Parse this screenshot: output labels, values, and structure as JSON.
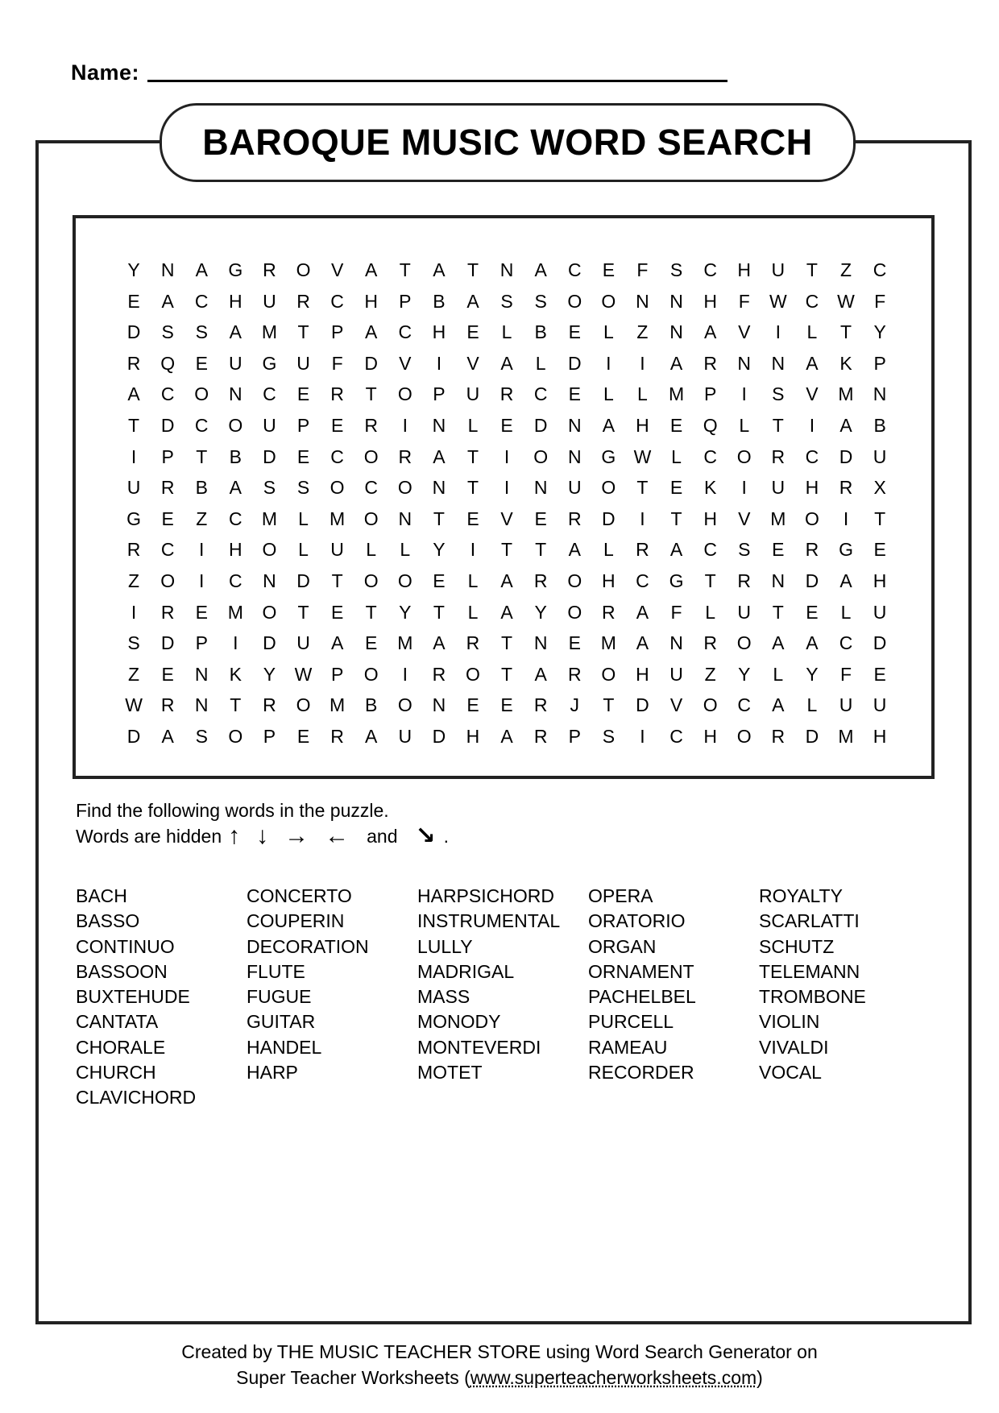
{
  "header": {
    "name_label": "Name:",
    "title": "BAROQUE MUSIC WORD SEARCH"
  },
  "grid": {
    "rows": [
      [
        "Y",
        "N",
        "A",
        "G",
        "R",
        "O",
        "V",
        "A",
        "T",
        "A",
        "T",
        "N",
        "A",
        "C",
        "E",
        "F",
        "S",
        "C",
        "H",
        "U",
        "T",
        "Z",
        "C"
      ],
      [
        "E",
        "A",
        "C",
        "H",
        "U",
        "R",
        "C",
        "H",
        "P",
        "B",
        "A",
        "S",
        "S",
        "O",
        "O",
        "N",
        "N",
        "H",
        "F",
        "W",
        "C",
        "W",
        "F"
      ],
      [
        "D",
        "S",
        "S",
        "A",
        "M",
        "T",
        "P",
        "A",
        "C",
        "H",
        "E",
        "L",
        "B",
        "E",
        "L",
        "Z",
        "N",
        "A",
        "V",
        "I",
        "L",
        "T",
        "Y"
      ],
      [
        "R",
        "Q",
        "E",
        "U",
        "G",
        "U",
        "F",
        "D",
        "V",
        "I",
        "V",
        "A",
        "L",
        "D",
        "I",
        "I",
        "A",
        "R",
        "N",
        "N",
        "A",
        "K",
        "P"
      ],
      [
        "A",
        "C",
        "O",
        "N",
        "C",
        "E",
        "R",
        "T",
        "O",
        "P",
        "U",
        "R",
        "C",
        "E",
        "L",
        "L",
        "M",
        "P",
        "I",
        "S",
        "V",
        "M",
        "N"
      ],
      [
        "T",
        "D",
        "C",
        "O",
        "U",
        "P",
        "E",
        "R",
        "I",
        "N",
        "L",
        "E",
        "D",
        "N",
        "A",
        "H",
        "E",
        "Q",
        "L",
        "T",
        "I",
        "A",
        "B"
      ],
      [
        "I",
        "P",
        "T",
        "B",
        "D",
        "E",
        "C",
        "O",
        "R",
        "A",
        "T",
        "I",
        "O",
        "N",
        "G",
        "W",
        "L",
        "C",
        "O",
        "R",
        "C",
        "D",
        "U"
      ],
      [
        "U",
        "R",
        "B",
        "A",
        "S",
        "S",
        "O",
        "C",
        "O",
        "N",
        "T",
        "I",
        "N",
        "U",
        "O",
        "T",
        "E",
        "K",
        "I",
        "U",
        "H",
        "R",
        "X"
      ],
      [
        "G",
        "E",
        "Z",
        "C",
        "M",
        "L",
        "M",
        "O",
        "N",
        "T",
        "E",
        "V",
        "E",
        "R",
        "D",
        "I",
        "T",
        "H",
        "V",
        "M",
        "O",
        "I",
        "T"
      ],
      [
        "R",
        "C",
        "I",
        "H",
        "O",
        "L",
        "U",
        "L",
        "L",
        "Y",
        "I",
        "T",
        "T",
        "A",
        "L",
        "R",
        "A",
        "C",
        "S",
        "E",
        "R",
        "G",
        "E"
      ],
      [
        "Z",
        "O",
        "I",
        "C",
        "N",
        "D",
        "T",
        "O",
        "O",
        "E",
        "L",
        "A",
        "R",
        "O",
        "H",
        "C",
        "G",
        "T",
        "R",
        "N",
        "D",
        "A",
        "H"
      ],
      [
        "I",
        "R",
        "E",
        "M",
        "O",
        "T",
        "E",
        "T",
        "Y",
        "T",
        "L",
        "A",
        "Y",
        "O",
        "R",
        "A",
        "F",
        "L",
        "U",
        "T",
        "E",
        "L",
        "U"
      ],
      [
        "S",
        "D",
        "P",
        "I",
        "D",
        "U",
        "A",
        "E",
        "M",
        "A",
        "R",
        "T",
        "N",
        "E",
        "M",
        "A",
        "N",
        "R",
        "O",
        "A",
        "A",
        "C",
        "D"
      ],
      [
        "Z",
        "E",
        "N",
        "K",
        "Y",
        "W",
        "P",
        "O",
        "I",
        "R",
        "O",
        "T",
        "A",
        "R",
        "O",
        "H",
        "U",
        "Z",
        "Y",
        "L",
        "Y",
        "F",
        "E"
      ],
      [
        "W",
        "R",
        "N",
        "T",
        "R",
        "O",
        "M",
        "B",
        "O",
        "N",
        "E",
        "E",
        "R",
        "J",
        "T",
        "D",
        "V",
        "O",
        "C",
        "A",
        "L",
        "U",
        "U"
      ],
      [
        "D",
        "A",
        "S",
        "O",
        "P",
        "E",
        "R",
        "A",
        "U",
        "D",
        "H",
        "A",
        "R",
        "P",
        "S",
        "I",
        "C",
        "H",
        "O",
        "R",
        "D",
        "M",
        "H"
      ]
    ]
  },
  "instructions": {
    "line1": "Find the following words in the puzzle.",
    "line2_prefix": "Words are hidden",
    "directions": [
      {
        "icon": "arrow-up-icon",
        "glyph": "↑"
      },
      {
        "icon": "arrow-down-icon",
        "glyph": "↓"
      },
      {
        "icon": "arrow-right-icon",
        "glyph": "→"
      },
      {
        "icon": "arrow-left-icon",
        "glyph": "←"
      }
    ],
    "and_text": "and",
    "last_direction": {
      "icon": "arrow-down-right-icon",
      "glyph": "↘"
    },
    "end_period": "."
  },
  "word_columns": [
    [
      "BACH",
      "BASSO",
      "CONTINUO",
      "BASSOON",
      "BUXTEHUDE",
      "CANTATA",
      "CHORALE",
      "CHURCH",
      "CLAVICHORD"
    ],
    [
      "CONCERTO",
      "COUPERIN",
      "DECORATION",
      "FLUTE",
      "FUGUE",
      "GUITAR",
      "HANDEL",
      "HARP"
    ],
    [
      "HARPSICHORD",
      "INSTRUMENTAL",
      "LULLY",
      "MADRIGAL",
      "MASS",
      "MONODY",
      "MONTEVERDI",
      "MOTET"
    ],
    [
      "OPERA",
      "ORATORIO",
      "ORGAN",
      "ORNAMENT",
      "PACHELBEL",
      "PURCELL",
      "RAMEAU",
      "RECORDER"
    ],
    [
      "ROYALTY",
      "SCARLATTI",
      "SCHUTZ",
      "TELEMANN",
      "TROMBONE",
      "VIOLIN",
      "VIVALDI",
      "VOCAL"
    ]
  ],
  "footer": {
    "line1": "Created by THE MUSIC TEACHER STORE using Word Search Generator on",
    "line2_prefix": "Super Teacher Worksheets (",
    "link": "www.superteacherworksheets.com",
    "line2_suffix": ")"
  }
}
